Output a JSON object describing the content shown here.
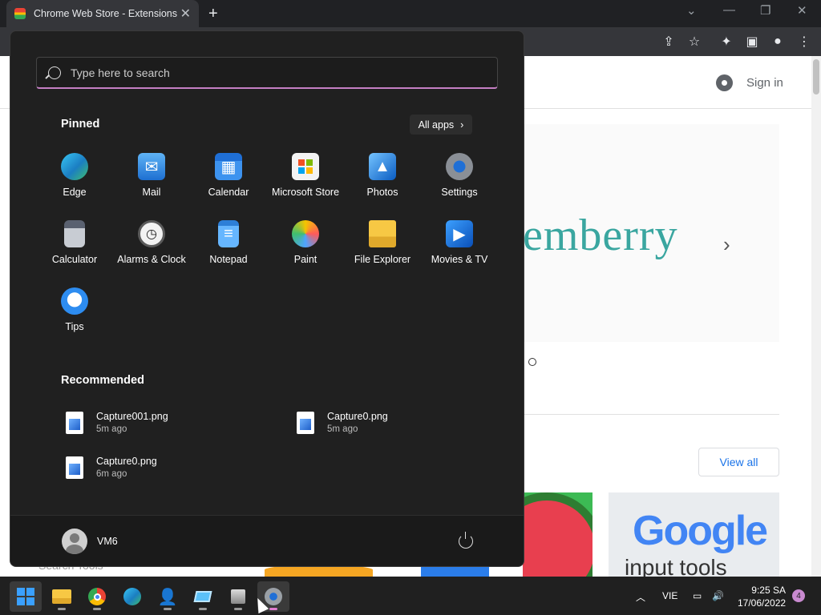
{
  "browser": {
    "tab_title": "Chrome Web Store - Extensions",
    "new_tab": "+",
    "tab_close": "✕"
  },
  "page": {
    "sign_in": "Sign in",
    "banner_text": "emberry",
    "view_all": "View all",
    "search_tools": "Search Tools",
    "tile_google": "Google",
    "tile_input_tools": "input tools"
  },
  "start_menu": {
    "search_placeholder": "Type here to search",
    "pinned_heading": "Pinned",
    "all_apps_label": "All apps",
    "pinned": [
      {
        "label": "Edge",
        "icon": "edge-icon"
      },
      {
        "label": "Mail",
        "icon": "mail-icon"
      },
      {
        "label": "Calendar",
        "icon": "calendar-icon"
      },
      {
        "label": "Microsoft Store",
        "icon": "store-icon"
      },
      {
        "label": "Photos",
        "icon": "photos-icon"
      },
      {
        "label": "Settings",
        "icon": "settings-icon"
      },
      {
        "label": "Calculator",
        "icon": "calculator-icon"
      },
      {
        "label": "Alarms & Clock",
        "icon": "clock-icon"
      },
      {
        "label": "Notepad",
        "icon": "notepad-icon"
      },
      {
        "label": "Paint",
        "icon": "paint-icon"
      },
      {
        "label": "File Explorer",
        "icon": "folder-icon"
      },
      {
        "label": "Movies & TV",
        "icon": "movies-icon"
      },
      {
        "label": "Tips",
        "icon": "tips-icon"
      }
    ],
    "recommended_heading": "Recommended",
    "recommended": [
      {
        "name": "Capture001.png",
        "time": "5m ago"
      },
      {
        "name": "Capture0.png",
        "time": "5m ago"
      },
      {
        "name": "Capture0.png",
        "time": "6m ago"
      }
    ],
    "user_name": "VM6"
  },
  "taskbar": {
    "language": "VIE",
    "time": "9:25 SA",
    "date": "17/06/2022",
    "notifications": "4"
  }
}
